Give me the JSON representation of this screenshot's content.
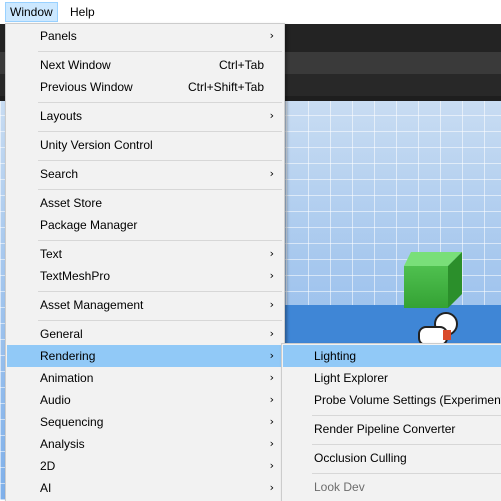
{
  "menubar": {
    "items": [
      {
        "label": "Window"
      },
      {
        "label": "Help"
      }
    ]
  },
  "window_menu": {
    "items": [
      {
        "label": "Panels",
        "submenu": true
      },
      {
        "label": "Next Window",
        "shortcut": "Ctrl+Tab"
      },
      {
        "label": "Previous Window",
        "shortcut": "Ctrl+Shift+Tab"
      },
      {
        "label": "Layouts",
        "submenu": true
      },
      {
        "label": "Unity Version Control"
      },
      {
        "label": "Search",
        "submenu": true
      },
      {
        "label": "Asset Store"
      },
      {
        "label": "Package Manager"
      },
      {
        "label": "Text",
        "submenu": true
      },
      {
        "label": "TextMeshPro",
        "submenu": true
      },
      {
        "label": "Asset Management",
        "submenu": true
      },
      {
        "label": "General",
        "submenu": true
      },
      {
        "label": "Rendering",
        "submenu": true,
        "highlighted": true
      },
      {
        "label": "Animation",
        "submenu": true
      },
      {
        "label": "Audio",
        "submenu": true
      },
      {
        "label": "Sequencing",
        "submenu": true
      },
      {
        "label": "Analysis",
        "submenu": true
      },
      {
        "label": "2D",
        "submenu": true
      },
      {
        "label": "AI",
        "submenu": true
      }
    ],
    "submenu_arrow": "›"
  },
  "rendering_submenu": {
    "items": [
      {
        "label": "Lighting",
        "highlighted": true
      },
      {
        "label": "Light Explorer"
      },
      {
        "label": "Probe Volume Settings (Experimenta"
      },
      {
        "label": "Render Pipeline Converter"
      },
      {
        "label": "Occlusion Culling"
      },
      {
        "label": "Look Dev",
        "disabled": true
      }
    ]
  },
  "colors": {
    "highlight": "#91c9f7",
    "menu_bg": "#f2f2f2",
    "scene_sky": "#a7c8ee",
    "cube": "#4fc04f",
    "plane": "#3f86d6"
  }
}
